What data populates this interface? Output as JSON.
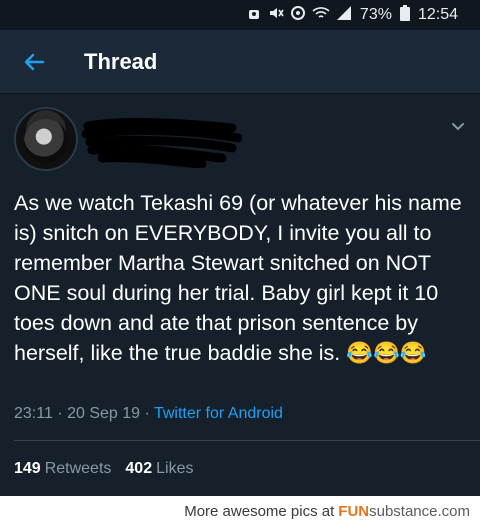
{
  "status_bar": {
    "battery": "73%",
    "time": "12:54"
  },
  "app_bar": {
    "title": "Thread"
  },
  "tweet": {
    "text": "As we watch Tekashi 69 (or whatever his name is) snitch on EVERYBODY, I invite you all to remember Martha Stewart snitched on NOT ONE soul during her trial. Baby girl kept it 10 toes down and ate that prison sentence by herself, like the true baddie she is. 😂😂😂",
    "time": "23:11",
    "date": "20 Sep 19",
    "source": "Twitter for Android",
    "retweets_count": "149",
    "retweets_label": "Retweets",
    "likes_count": "402",
    "likes_label": "Likes"
  },
  "footer": {
    "prefix": "More awesome pics at",
    "brand_f": "FUN",
    "brand_s": "substance.com"
  },
  "colors": {
    "background": "#15202b",
    "app_bar": "#1c2938",
    "accent": "#1da1f2",
    "muted": "#8899a6"
  }
}
